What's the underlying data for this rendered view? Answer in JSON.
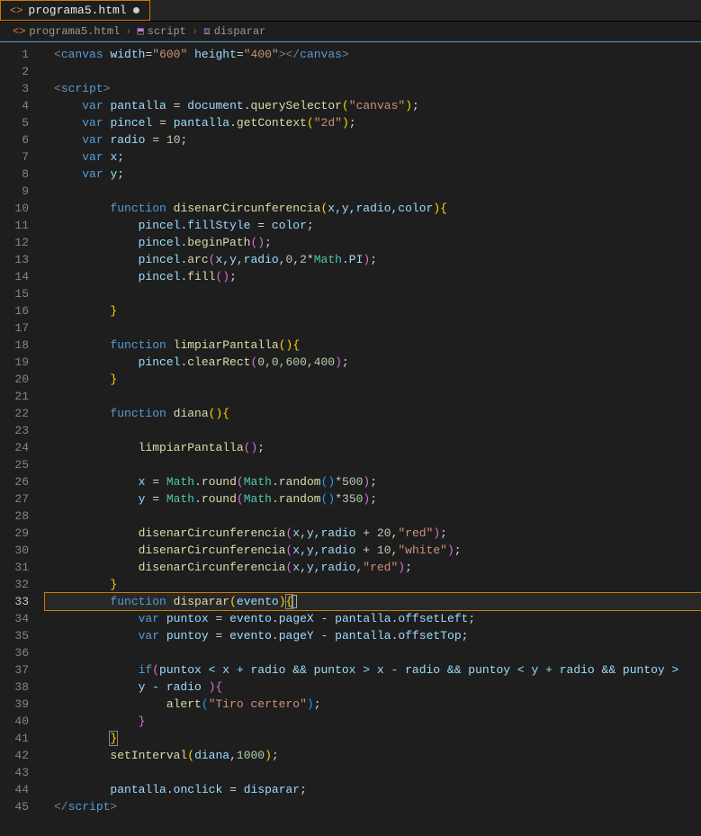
{
  "tab": {
    "filename": "programa5.html",
    "dirty": true
  },
  "breadcrumb": {
    "file": "programa5.html",
    "segment1": "script",
    "segment2": "disparar"
  },
  "gutter": {
    "line_count": 45,
    "current_line": 33
  },
  "code": {
    "l1": {
      "tag": "canvas",
      "a1": "width",
      "v1": "\"600\"",
      "a2": "height",
      "v2": "\"400\""
    },
    "l3": {
      "tag": "script"
    },
    "l4": {
      "kw": "var",
      "v": "pantalla",
      "obj": "document",
      "fn": "querySelector",
      "arg": "\"canvas\""
    },
    "l5": {
      "kw": "var",
      "v": "pincel",
      "obj": "pantalla",
      "fn": "getContext",
      "arg": "\"2d\""
    },
    "l6": {
      "kw": "var",
      "v": "radio",
      "n": "10"
    },
    "l7": {
      "kw": "var",
      "v": "x"
    },
    "l8": {
      "kw": "var",
      "v": "y"
    },
    "l10": {
      "kw": "function",
      "fn": "disenarCircunferencia",
      "params": "x,y,radio,color"
    },
    "l11": {
      "obj": "pincel",
      "prop": "fillStyle",
      "rhs": "color"
    },
    "l12": {
      "obj": "pincel",
      "fn": "beginPath"
    },
    "l13": {
      "obj": "pincel",
      "fn": "arc",
      "args_a": "x,y,radio,",
      "n0": "0",
      "n2": "2",
      "mathpi": "Math.PI"
    },
    "l14": {
      "obj": "pincel",
      "fn": "fill"
    },
    "l18": {
      "kw": "function",
      "fn": "limpiarPantalla"
    },
    "l19": {
      "obj": "pincel",
      "fn": "clearRect",
      "args": "0,0,600,400"
    },
    "l22": {
      "kw": "function",
      "fn": "diana"
    },
    "l24": {
      "fn": "limpiarPantalla"
    },
    "l26": {
      "v": "x",
      "obj": "Math",
      "fn1": "round",
      "fn2": "random",
      "n": "500"
    },
    "l27": {
      "v": "y",
      "obj": "Math",
      "fn1": "round",
      "fn2": "random",
      "n": "350"
    },
    "l29": {
      "fn": "disenarCircunferencia",
      "args": "x,y,radio",
      "n": "20",
      "s": "\"red\""
    },
    "l30": {
      "fn": "disenarCircunferencia",
      "args": "x,y,radio",
      "n": "10",
      "s": "\"white\""
    },
    "l31": {
      "fn": "disenarCircunferencia",
      "args": "x,y,radio,",
      "s": "\"red\""
    },
    "l33": {
      "kw": "function",
      "fn": "disparar",
      "param": "evento"
    },
    "l34": {
      "kw": "var",
      "v": "puntox",
      "obj1": "evento",
      "p1": "pageX",
      "obj2": "pantalla",
      "p2": "offsetLeft"
    },
    "l35": {
      "kw": "var",
      "v": "puntoy",
      "obj1": "evento",
      "p1": "pageY",
      "obj2": "pantalla",
      "p2": "offsetTop"
    },
    "l37": {
      "kw": "if",
      "cond": "puntox < x + radio && puntox > x - radio && puntoy < y + radio && puntoy > "
    },
    "l37b": {
      "cond": "y - radio "
    },
    "l39": {
      "fn": "alert",
      "s": "\"Tiro certero\""
    },
    "l42": {
      "fn": "setInterval",
      "arg1": "diana",
      "n": "1000"
    },
    "l44": {
      "obj": "pantalla",
      "prop": "onclick",
      "rhs": "disparar"
    },
    "l45": {
      "tag": "script"
    }
  }
}
